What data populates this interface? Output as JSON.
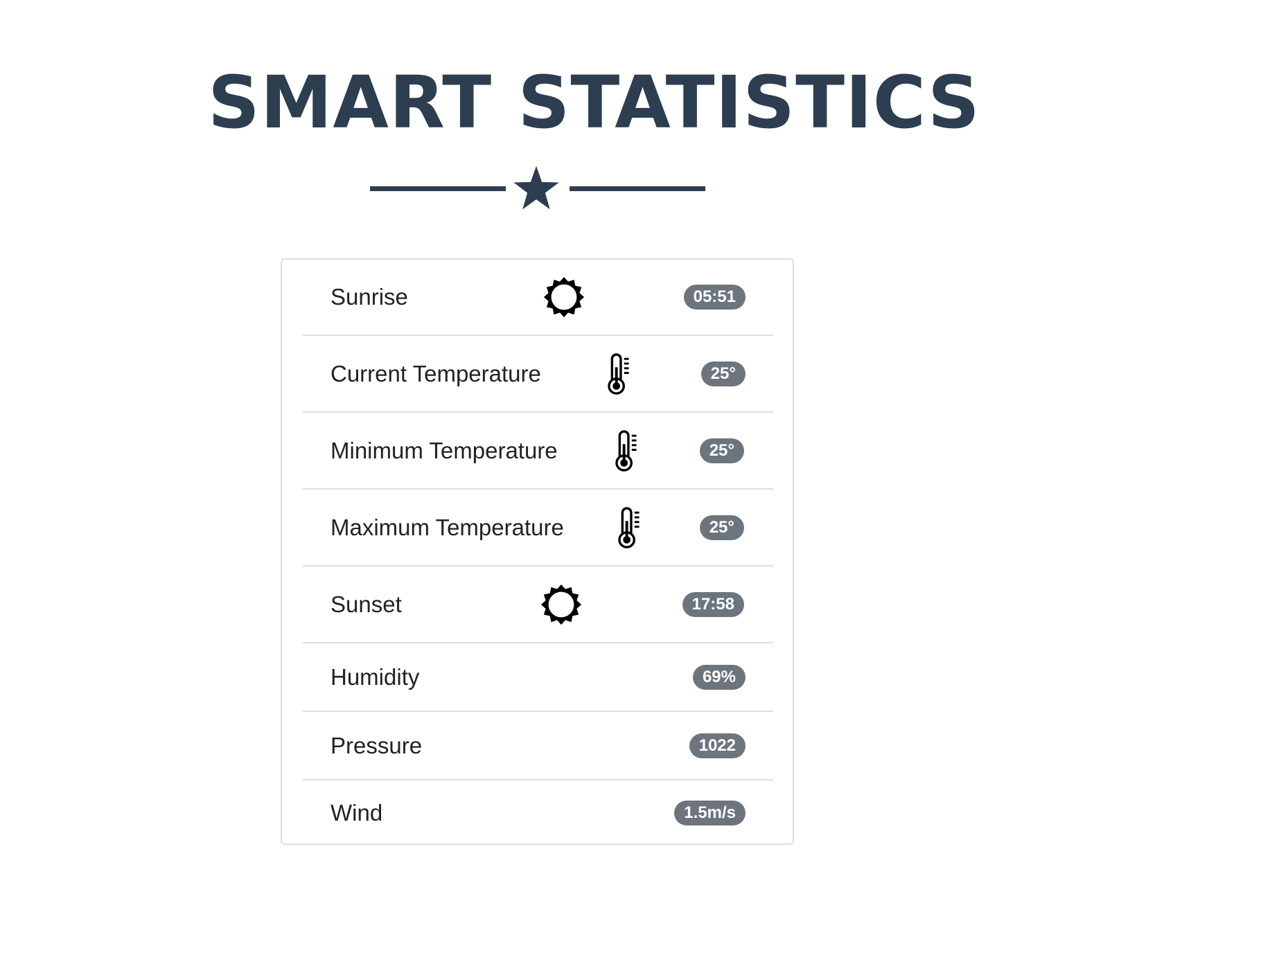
{
  "header": {
    "title": "SMART STATISTICS"
  },
  "stats": {
    "sunrise": {
      "label": "Sunrise",
      "value": "05:51",
      "icon": "sun-icon"
    },
    "current_temperature": {
      "label": "Current Temperature",
      "value": "25°",
      "icon": "thermometer-icon"
    },
    "minimum_temperature": {
      "label": "Minimum Temperature",
      "value": "25°",
      "icon": "thermometer-icon"
    },
    "maximum_temperature": {
      "label": "Maximum Temperature",
      "value": "25°",
      "icon": "thermometer-icon"
    },
    "sunset": {
      "label": "Sunset",
      "value": "17:58",
      "icon": "sun-icon"
    },
    "humidity": {
      "label": "Humidity",
      "value": "69%"
    },
    "pressure": {
      "label": "Pressure",
      "value": "1022"
    },
    "wind": {
      "label": "Wind",
      "value": "1.5m/s"
    }
  },
  "colors": {
    "heading": "#2c3e50",
    "badge_background": "#6c757d",
    "badge_text": "#ffffff",
    "row_divider": "#dedede",
    "card_border": "#dcdcdc"
  }
}
